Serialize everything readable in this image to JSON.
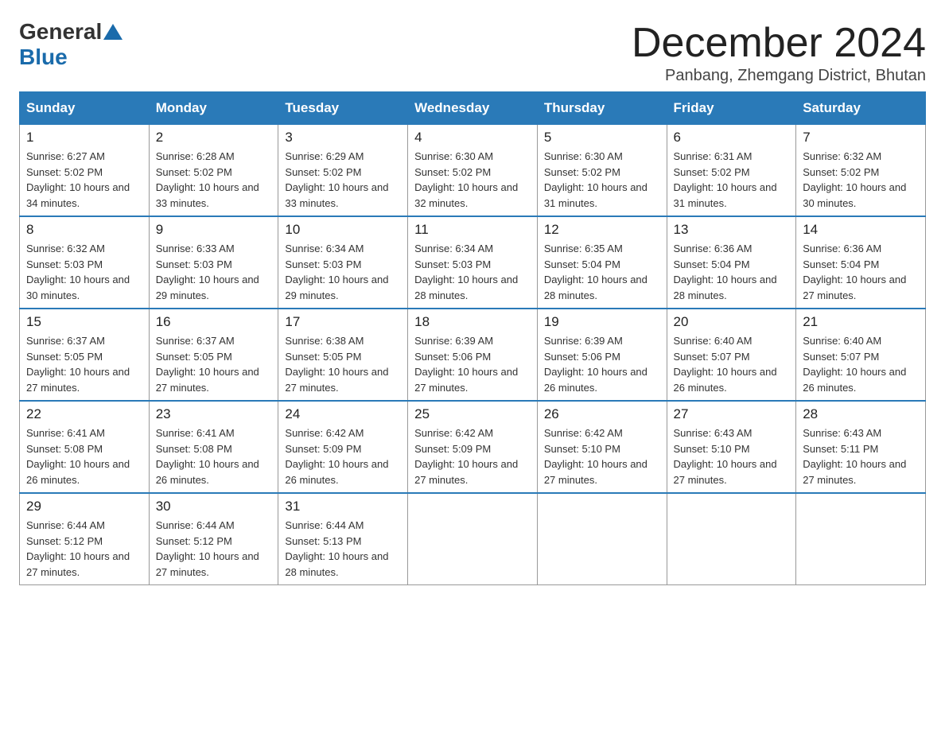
{
  "header": {
    "logo_general": "General",
    "logo_blue": "Blue",
    "month_title": "December 2024",
    "subtitle": "Panbang, Zhemgang District, Bhutan"
  },
  "weekdays": [
    "Sunday",
    "Monday",
    "Tuesday",
    "Wednesday",
    "Thursday",
    "Friday",
    "Saturday"
  ],
  "weeks": [
    [
      {
        "day": "1",
        "sunrise": "6:27 AM",
        "sunset": "5:02 PM",
        "daylight": "10 hours and 34 minutes."
      },
      {
        "day": "2",
        "sunrise": "6:28 AM",
        "sunset": "5:02 PM",
        "daylight": "10 hours and 33 minutes."
      },
      {
        "day": "3",
        "sunrise": "6:29 AM",
        "sunset": "5:02 PM",
        "daylight": "10 hours and 33 minutes."
      },
      {
        "day": "4",
        "sunrise": "6:30 AM",
        "sunset": "5:02 PM",
        "daylight": "10 hours and 32 minutes."
      },
      {
        "day": "5",
        "sunrise": "6:30 AM",
        "sunset": "5:02 PM",
        "daylight": "10 hours and 31 minutes."
      },
      {
        "day": "6",
        "sunrise": "6:31 AM",
        "sunset": "5:02 PM",
        "daylight": "10 hours and 31 minutes."
      },
      {
        "day": "7",
        "sunrise": "6:32 AM",
        "sunset": "5:02 PM",
        "daylight": "10 hours and 30 minutes."
      }
    ],
    [
      {
        "day": "8",
        "sunrise": "6:32 AM",
        "sunset": "5:03 PM",
        "daylight": "10 hours and 30 minutes."
      },
      {
        "day": "9",
        "sunrise": "6:33 AM",
        "sunset": "5:03 PM",
        "daylight": "10 hours and 29 minutes."
      },
      {
        "day": "10",
        "sunrise": "6:34 AM",
        "sunset": "5:03 PM",
        "daylight": "10 hours and 29 minutes."
      },
      {
        "day": "11",
        "sunrise": "6:34 AM",
        "sunset": "5:03 PM",
        "daylight": "10 hours and 28 minutes."
      },
      {
        "day": "12",
        "sunrise": "6:35 AM",
        "sunset": "5:04 PM",
        "daylight": "10 hours and 28 minutes."
      },
      {
        "day": "13",
        "sunrise": "6:36 AM",
        "sunset": "5:04 PM",
        "daylight": "10 hours and 28 minutes."
      },
      {
        "day": "14",
        "sunrise": "6:36 AM",
        "sunset": "5:04 PM",
        "daylight": "10 hours and 27 minutes."
      }
    ],
    [
      {
        "day": "15",
        "sunrise": "6:37 AM",
        "sunset": "5:05 PM",
        "daylight": "10 hours and 27 minutes."
      },
      {
        "day": "16",
        "sunrise": "6:37 AM",
        "sunset": "5:05 PM",
        "daylight": "10 hours and 27 minutes."
      },
      {
        "day": "17",
        "sunrise": "6:38 AM",
        "sunset": "5:05 PM",
        "daylight": "10 hours and 27 minutes."
      },
      {
        "day": "18",
        "sunrise": "6:39 AM",
        "sunset": "5:06 PM",
        "daylight": "10 hours and 27 minutes."
      },
      {
        "day": "19",
        "sunrise": "6:39 AM",
        "sunset": "5:06 PM",
        "daylight": "10 hours and 26 minutes."
      },
      {
        "day": "20",
        "sunrise": "6:40 AM",
        "sunset": "5:07 PM",
        "daylight": "10 hours and 26 minutes."
      },
      {
        "day": "21",
        "sunrise": "6:40 AM",
        "sunset": "5:07 PM",
        "daylight": "10 hours and 26 minutes."
      }
    ],
    [
      {
        "day": "22",
        "sunrise": "6:41 AM",
        "sunset": "5:08 PM",
        "daylight": "10 hours and 26 minutes."
      },
      {
        "day": "23",
        "sunrise": "6:41 AM",
        "sunset": "5:08 PM",
        "daylight": "10 hours and 26 minutes."
      },
      {
        "day": "24",
        "sunrise": "6:42 AM",
        "sunset": "5:09 PM",
        "daylight": "10 hours and 26 minutes."
      },
      {
        "day": "25",
        "sunrise": "6:42 AM",
        "sunset": "5:09 PM",
        "daylight": "10 hours and 27 minutes."
      },
      {
        "day": "26",
        "sunrise": "6:42 AM",
        "sunset": "5:10 PM",
        "daylight": "10 hours and 27 minutes."
      },
      {
        "day": "27",
        "sunrise": "6:43 AM",
        "sunset": "5:10 PM",
        "daylight": "10 hours and 27 minutes."
      },
      {
        "day": "28",
        "sunrise": "6:43 AM",
        "sunset": "5:11 PM",
        "daylight": "10 hours and 27 minutes."
      }
    ],
    [
      {
        "day": "29",
        "sunrise": "6:44 AM",
        "sunset": "5:12 PM",
        "daylight": "10 hours and 27 minutes."
      },
      {
        "day": "30",
        "sunrise": "6:44 AM",
        "sunset": "5:12 PM",
        "daylight": "10 hours and 27 minutes."
      },
      {
        "day": "31",
        "sunrise": "6:44 AM",
        "sunset": "5:13 PM",
        "daylight": "10 hours and 28 minutes."
      },
      null,
      null,
      null,
      null
    ]
  ],
  "labels": {
    "sunrise_prefix": "Sunrise: ",
    "sunset_prefix": "Sunset: ",
    "daylight_prefix": "Daylight: "
  }
}
